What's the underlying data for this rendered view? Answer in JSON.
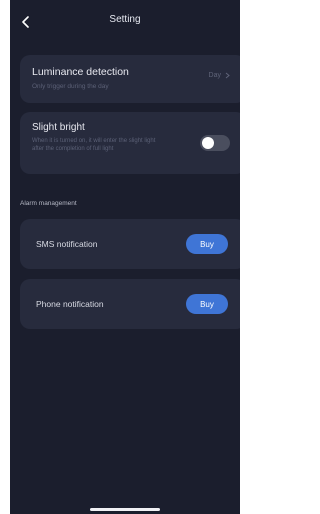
{
  "header": {
    "title": "Setting",
    "back_icon": "chevron-left-icon"
  },
  "luminance": {
    "title": "Luminance detection",
    "subtitle": "Only trigger during the day",
    "value": "Day",
    "chevron_icon": "chevron-right-icon"
  },
  "slight_bright": {
    "title": "Slight bright",
    "description": "When it is turned on, it will enter the slight light after the completion of full light",
    "enabled": false
  },
  "alarm_management": {
    "section_label": "Alarm management",
    "items": [
      {
        "label": "SMS notification",
        "button_label": "Buy"
      },
      {
        "label": "Phone notification",
        "button_label": "Buy"
      }
    ]
  },
  "colors": {
    "background": "#1b1e2d",
    "card": "#272b3d",
    "accent": "#3f75d6",
    "toggle_off": "#4a4e5e"
  }
}
